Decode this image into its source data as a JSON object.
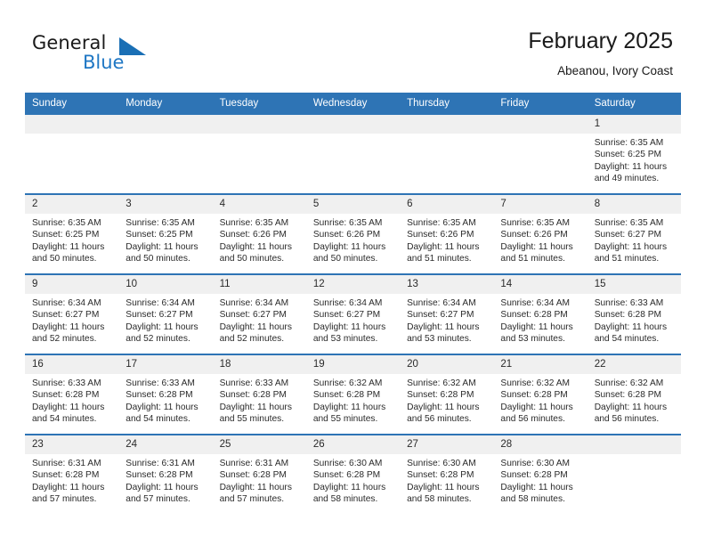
{
  "brand": {
    "name_part1": "General",
    "name_part2": "Blue",
    "mark": "triangle-flag-icon",
    "accent_color": "#1f77c4"
  },
  "header": {
    "title": "February 2025",
    "subtitle": "Abeanou, Ivory Coast"
  },
  "colors": {
    "header_bg": "#2e74b5",
    "header_text": "#ffffff",
    "daynum_bg": "#f0f0f0",
    "cell_bg": "#ffffff",
    "row_divider": "#2e74b5",
    "body_text": "#2a2a2a"
  },
  "labels": {
    "sunrise": "Sunrise:",
    "sunset": "Sunset:",
    "daylight": "Daylight:"
  },
  "weekdays": [
    "Sunday",
    "Monday",
    "Tuesday",
    "Wednesday",
    "Thursday",
    "Friday",
    "Saturday"
  ],
  "weeks": [
    [
      {
        "day": "",
        "empty": true
      },
      {
        "day": "",
        "empty": true
      },
      {
        "day": "",
        "empty": true
      },
      {
        "day": "",
        "empty": true
      },
      {
        "day": "",
        "empty": true
      },
      {
        "day": "",
        "empty": true
      },
      {
        "day": "1",
        "sunrise": "Sunrise: 6:35 AM",
        "sunset": "Sunset: 6:25 PM",
        "daylight_line1": "Daylight: 11 hours",
        "daylight_line2": "and 49 minutes."
      }
    ],
    [
      {
        "day": "2",
        "sunrise": "Sunrise: 6:35 AM",
        "sunset": "Sunset: 6:25 PM",
        "daylight_line1": "Daylight: 11 hours",
        "daylight_line2": "and 50 minutes."
      },
      {
        "day": "3",
        "sunrise": "Sunrise: 6:35 AM",
        "sunset": "Sunset: 6:25 PM",
        "daylight_line1": "Daylight: 11 hours",
        "daylight_line2": "and 50 minutes."
      },
      {
        "day": "4",
        "sunrise": "Sunrise: 6:35 AM",
        "sunset": "Sunset: 6:26 PM",
        "daylight_line1": "Daylight: 11 hours",
        "daylight_line2": "and 50 minutes."
      },
      {
        "day": "5",
        "sunrise": "Sunrise: 6:35 AM",
        "sunset": "Sunset: 6:26 PM",
        "daylight_line1": "Daylight: 11 hours",
        "daylight_line2": "and 50 minutes."
      },
      {
        "day": "6",
        "sunrise": "Sunrise: 6:35 AM",
        "sunset": "Sunset: 6:26 PM",
        "daylight_line1": "Daylight: 11 hours",
        "daylight_line2": "and 51 minutes."
      },
      {
        "day": "7",
        "sunrise": "Sunrise: 6:35 AM",
        "sunset": "Sunset: 6:26 PM",
        "daylight_line1": "Daylight: 11 hours",
        "daylight_line2": "and 51 minutes."
      },
      {
        "day": "8",
        "sunrise": "Sunrise: 6:35 AM",
        "sunset": "Sunset: 6:27 PM",
        "daylight_line1": "Daylight: 11 hours",
        "daylight_line2": "and 51 minutes."
      }
    ],
    [
      {
        "day": "9",
        "sunrise": "Sunrise: 6:34 AM",
        "sunset": "Sunset: 6:27 PM",
        "daylight_line1": "Daylight: 11 hours",
        "daylight_line2": "and 52 minutes."
      },
      {
        "day": "10",
        "sunrise": "Sunrise: 6:34 AM",
        "sunset": "Sunset: 6:27 PM",
        "daylight_line1": "Daylight: 11 hours",
        "daylight_line2": "and 52 minutes."
      },
      {
        "day": "11",
        "sunrise": "Sunrise: 6:34 AM",
        "sunset": "Sunset: 6:27 PM",
        "daylight_line1": "Daylight: 11 hours",
        "daylight_line2": "and 52 minutes."
      },
      {
        "day": "12",
        "sunrise": "Sunrise: 6:34 AM",
        "sunset": "Sunset: 6:27 PM",
        "daylight_line1": "Daylight: 11 hours",
        "daylight_line2": "and 53 minutes."
      },
      {
        "day": "13",
        "sunrise": "Sunrise: 6:34 AM",
        "sunset": "Sunset: 6:27 PM",
        "daylight_line1": "Daylight: 11 hours",
        "daylight_line2": "and 53 minutes."
      },
      {
        "day": "14",
        "sunrise": "Sunrise: 6:34 AM",
        "sunset": "Sunset: 6:28 PM",
        "daylight_line1": "Daylight: 11 hours",
        "daylight_line2": "and 53 minutes."
      },
      {
        "day": "15",
        "sunrise": "Sunrise: 6:33 AM",
        "sunset": "Sunset: 6:28 PM",
        "daylight_line1": "Daylight: 11 hours",
        "daylight_line2": "and 54 minutes."
      }
    ],
    [
      {
        "day": "16",
        "sunrise": "Sunrise: 6:33 AM",
        "sunset": "Sunset: 6:28 PM",
        "daylight_line1": "Daylight: 11 hours",
        "daylight_line2": "and 54 minutes."
      },
      {
        "day": "17",
        "sunrise": "Sunrise: 6:33 AM",
        "sunset": "Sunset: 6:28 PM",
        "daylight_line1": "Daylight: 11 hours",
        "daylight_line2": "and 54 minutes."
      },
      {
        "day": "18",
        "sunrise": "Sunrise: 6:33 AM",
        "sunset": "Sunset: 6:28 PM",
        "daylight_line1": "Daylight: 11 hours",
        "daylight_line2": "and 55 minutes."
      },
      {
        "day": "19",
        "sunrise": "Sunrise: 6:32 AM",
        "sunset": "Sunset: 6:28 PM",
        "daylight_line1": "Daylight: 11 hours",
        "daylight_line2": "and 55 minutes."
      },
      {
        "day": "20",
        "sunrise": "Sunrise: 6:32 AM",
        "sunset": "Sunset: 6:28 PM",
        "daylight_line1": "Daylight: 11 hours",
        "daylight_line2": "and 56 minutes."
      },
      {
        "day": "21",
        "sunrise": "Sunrise: 6:32 AM",
        "sunset": "Sunset: 6:28 PM",
        "daylight_line1": "Daylight: 11 hours",
        "daylight_line2": "and 56 minutes."
      },
      {
        "day": "22",
        "sunrise": "Sunrise: 6:32 AM",
        "sunset": "Sunset: 6:28 PM",
        "daylight_line1": "Daylight: 11 hours",
        "daylight_line2": "and 56 minutes."
      }
    ],
    [
      {
        "day": "23",
        "sunrise": "Sunrise: 6:31 AM",
        "sunset": "Sunset: 6:28 PM",
        "daylight_line1": "Daylight: 11 hours",
        "daylight_line2": "and 57 minutes."
      },
      {
        "day": "24",
        "sunrise": "Sunrise: 6:31 AM",
        "sunset": "Sunset: 6:28 PM",
        "daylight_line1": "Daylight: 11 hours",
        "daylight_line2": "and 57 minutes."
      },
      {
        "day": "25",
        "sunrise": "Sunrise: 6:31 AM",
        "sunset": "Sunset: 6:28 PM",
        "daylight_line1": "Daylight: 11 hours",
        "daylight_line2": "and 57 minutes."
      },
      {
        "day": "26",
        "sunrise": "Sunrise: 6:30 AM",
        "sunset": "Sunset: 6:28 PM",
        "daylight_line1": "Daylight: 11 hours",
        "daylight_line2": "and 58 minutes."
      },
      {
        "day": "27",
        "sunrise": "Sunrise: 6:30 AM",
        "sunset": "Sunset: 6:28 PM",
        "daylight_line1": "Daylight: 11 hours",
        "daylight_line2": "and 58 minutes."
      },
      {
        "day": "28",
        "sunrise": "Sunrise: 6:30 AM",
        "sunset": "Sunset: 6:28 PM",
        "daylight_line1": "Daylight: 11 hours",
        "daylight_line2": "and 58 minutes."
      },
      {
        "day": "",
        "empty": true
      }
    ]
  ]
}
